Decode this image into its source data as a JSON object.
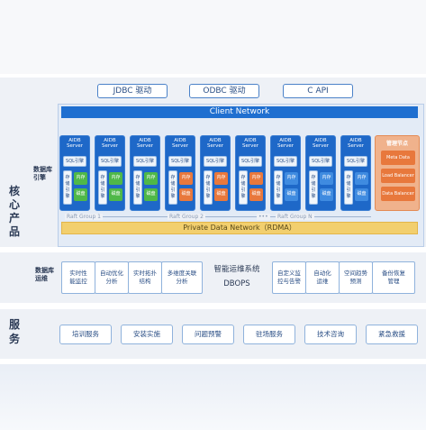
{
  "core": {
    "side_label": "核心产品",
    "engine_label": "数据库引擎",
    "apis": [
      "JDBC 驱动",
      "ODBC 驱动",
      "C API"
    ],
    "client_network": "Client Network",
    "servers": [
      {
        "title": "AIDB\nServer",
        "sql": "SQL引擎",
        "store": "存储引擎",
        "mem": "内存",
        "disk": "磁盘",
        "highlight": "green"
      },
      {
        "title": "AIDB\nServer",
        "sql": "SQL引擎",
        "store": "存储引擎",
        "mem": "内存",
        "disk": "磁盘",
        "highlight": "green"
      },
      {
        "title": "AIDB\nServer",
        "sql": "SQL引擎",
        "store": "存储引擎",
        "mem": "内存",
        "disk": "磁盘",
        "highlight": "green"
      },
      {
        "title": "AIDB\nServer",
        "sql": "SQL引擎",
        "store": "存储引擎",
        "mem": "内存",
        "disk": "磁盘",
        "highlight": "orange"
      },
      {
        "title": "AIDB\nServer",
        "sql": "SQL引擎",
        "store": "存储引擎",
        "mem": "内存",
        "disk": "磁盘",
        "highlight": "orange"
      },
      {
        "title": "AIDB\nServer",
        "sql": "SQL引擎",
        "store": "存储引擎",
        "mem": "内存",
        "disk": "磁盘",
        "highlight": "orange"
      },
      {
        "title": "AIDB\nServer",
        "sql": "SQL引擎",
        "store": "存储引擎",
        "mem": "内存",
        "disk": "磁盘",
        "highlight": "blue"
      },
      {
        "title": "AIDB\nServer",
        "sql": "SQL引擎",
        "store": "存储引擎",
        "mem": "内存",
        "disk": "磁盘",
        "highlight": "blue"
      },
      {
        "title": "AIDB\nServer",
        "sql": "SQL引擎",
        "store": "存储引擎",
        "mem": "内存",
        "disk": "磁盘",
        "highlight": "blue"
      }
    ],
    "management": {
      "title": "管理节点",
      "items": [
        "Meta Data",
        "Load Balancer",
        "Data Balancer"
      ]
    },
    "raft_groups": [
      "Raft Group 1",
      "Raft Group 2",
      "•••",
      "Raft Group N"
    ],
    "private_network": "Private Data Network（RDMA）"
  },
  "ops": {
    "label": "数据库运维",
    "center_title": "智能运维系统",
    "center_sub": "DBOPS",
    "tools_left": [
      "实时性\n能监控",
      "自动优化\n分析",
      "实时拓扑\n结构",
      "多维度关联\n分析"
    ],
    "tools_right": [
      "自定义监\n控与告警",
      "自动化\n运维",
      "空间趋势\n预测",
      "备份恢复\n管理"
    ]
  },
  "services": {
    "side_label": "服务",
    "items": [
      "培训服务",
      "安装实施",
      "问题预警",
      "驻场服务",
      "技术咨询",
      "紧急救援"
    ]
  },
  "colors": {
    "primary": "#1f6fd0",
    "green": "#4fb848",
    "orange": "#e8783c",
    "blue": "#3f8be0",
    "mgmt": "#f0b28c"
  }
}
